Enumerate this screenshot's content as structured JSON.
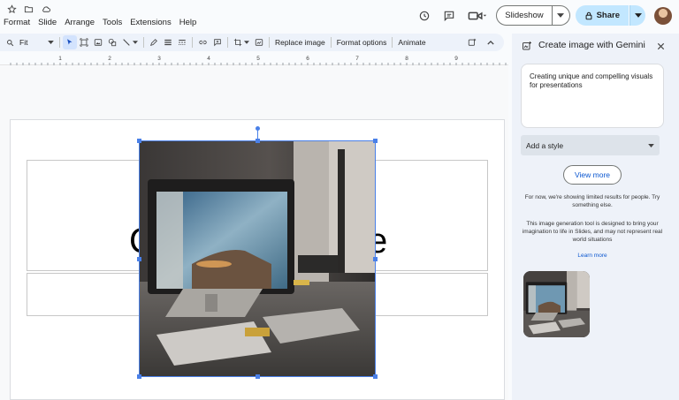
{
  "menu": {
    "items": [
      "Format",
      "Slide",
      "Arrange",
      "Tools",
      "Extensions",
      "Help"
    ]
  },
  "header": {
    "slideshow_label": "Slideshow",
    "share_label": "Share"
  },
  "toolbar": {
    "zoom_label": "Fit",
    "replace_image_label": "Replace image",
    "format_options_label": "Format options",
    "animate_label": "Animate"
  },
  "ruler": {
    "numbers": [
      "1",
      "2",
      "3",
      "4",
      "5",
      "6",
      "7",
      "8",
      "9"
    ]
  },
  "slide": {
    "title_left": "C",
    "title_right": "e"
  },
  "panel": {
    "title": "Create image with Gemini",
    "prompt_text": "Creating unique and compelling visuals for presentations",
    "style_placeholder": "Add a style",
    "view_more_label": "View more",
    "limited_notice": "For now, we're showing limited results for people. Try something else.",
    "disclaimer": "This image generation tool is designed to bring your imagination to life in Slides, and may not represent real world situations",
    "learn_more_label": "Learn more"
  },
  "colors": {
    "accent_blue": "#0b57d0",
    "share_bg": "#c2e7ff",
    "selection": "#4a80e8",
    "panel_bg": "#eef2f9"
  },
  "icons": [
    "star-icon",
    "folder-move-icon",
    "cloud-saved-icon",
    "history-icon",
    "comments-icon",
    "video-call-icon",
    "lock-icon",
    "chevron-down-icon",
    "close-icon",
    "create-image-icon"
  ]
}
